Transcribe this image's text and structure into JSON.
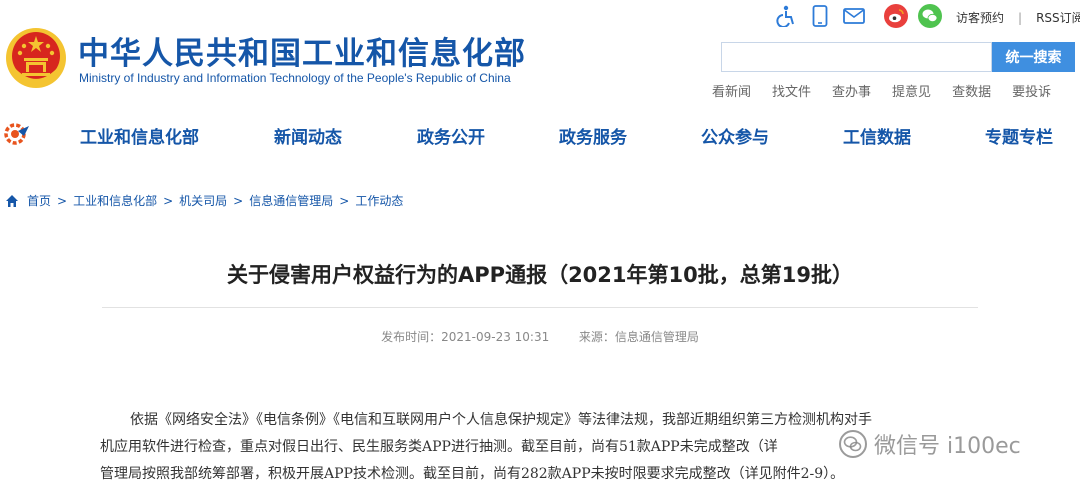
{
  "header": {
    "title": "中华人民共和国工业和信息化部",
    "subtitle": "Ministry of Industry and Information Technology of the People's Republic of China",
    "top_icons": [
      "accessibility-icon",
      "mobile-icon",
      "mail-icon",
      "weibo-icon",
      "wechat-icon"
    ],
    "top_links": [
      "访客预约",
      "RSS订阅"
    ],
    "search": {
      "button": "统一搜索",
      "placeholder": ""
    },
    "quick_links": [
      "看新闻",
      "找文件",
      "查办事",
      "提意见",
      "查数据",
      "要投诉"
    ]
  },
  "nav": {
    "items": [
      "工业和信息化部",
      "新闻动态",
      "政务公开",
      "政务服务",
      "公众参与",
      "工信数据",
      "专题专栏"
    ]
  },
  "breadcrumb": [
    "首页",
    "工业和信息化部",
    "机关司局",
    "信息通信管理局",
    "工作动态"
  ],
  "article": {
    "title": "关于侵害用户权益行为的APP通报（2021年第10批，总第19批）",
    "publish_time": "发布时间：2021-09-23 10:31",
    "source": "来源：信息通信管理局",
    "paragraph_lines": [
      "依据《网络安全法》《电信条例》《电信和互联网用户个人信息保护规定》等法律法规，我部近期组织第三方检测机构对手",
      "机应用软件进行检查，重点对假日出行、民生服务类APP进行抽测。截至目前，尚有51款APP未完成整改（详",
      "管理局按照我部统筹部署，积极开展APP技术检测。截至目前，尚有282款APP未按时限要求完成整改（详见附件2-9）。"
    ]
  },
  "watermark": {
    "text": "微信号 i100ec"
  },
  "colors": {
    "brand": "#1556a8",
    "search_button": "#3f8fe0",
    "emblem_red": "#d7261e",
    "emblem_gold": "#f4c431"
  }
}
